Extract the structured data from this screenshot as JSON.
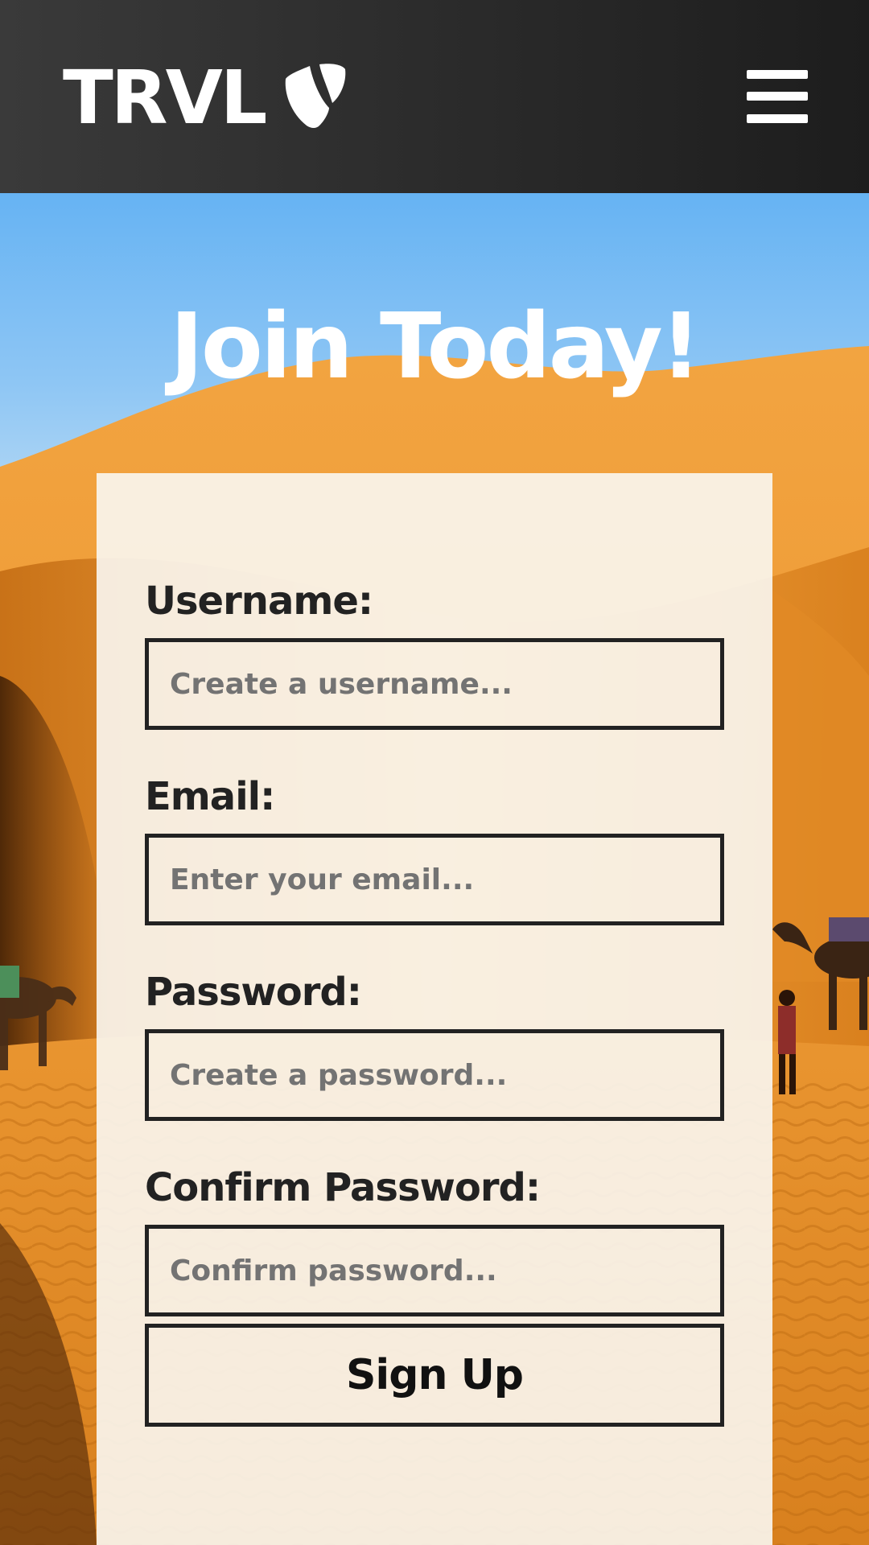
{
  "header": {
    "brand_text": "TRVL",
    "logo_icon": "typo3-logo-icon",
    "menu_icon": "hamburger-menu-icon"
  },
  "hero": {
    "title": "Join Today!",
    "background_image": "desert-dunes-camel-caravan"
  },
  "form": {
    "username": {
      "label": "Username:",
      "placeholder": "Create a username...",
      "value": ""
    },
    "email": {
      "label": "Email:",
      "placeholder": "Enter your email...",
      "value": ""
    },
    "password": {
      "label": "Password:",
      "placeholder": "Create a password...",
      "value": ""
    },
    "confirm_password": {
      "label": "Confirm Password:",
      "placeholder": "Confirm password...",
      "value": ""
    },
    "submit_label": "Sign Up"
  },
  "colors": {
    "header_bg": "#2a2a2a",
    "header_text": "#ffffff",
    "sky": "#66b3f3",
    "sand": "#f3a23c",
    "card_bg": "#faf7f2",
    "border": "#222222",
    "label_text": "#222222",
    "placeholder_text": "#737373"
  }
}
